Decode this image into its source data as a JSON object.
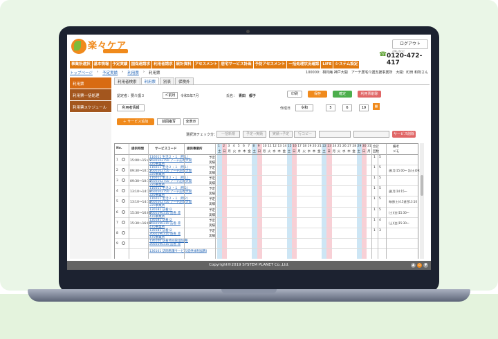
{
  "app": {
    "logo_text": "楽々ケア"
  },
  "header": {
    "logout_label": "ログアウト",
    "tel_label": "お問い合わせ",
    "tel": "0120-472-417"
  },
  "nav": [
    "事業所選択",
    "基本情報",
    "予定実績",
    "国保連請求",
    "利用者請求",
    "統計資料",
    "アセスメント",
    "居宅サービス計画",
    "予防アセスメント",
    "一括処理状況確認",
    "LIFE",
    "システム設定"
  ],
  "breadcrumb": {
    "items": [
      "トップページ",
      "予定実績",
      "利用票",
      "利用票"
    ],
    "office": "100000：相月庵 神戸大開　アーチ居宅介護支援事業所　大開：町田 和則さん"
  },
  "sidebar": [
    "利用票",
    "利用票一括処理",
    "利用票スケジュール"
  ],
  "tabs": [
    "利用者検索",
    "利用票",
    "別表",
    "保険外"
  ],
  "form": {
    "cert_label": "認定者：要介護３",
    "prev_label": "＜前月",
    "month_label": "令和5年7月",
    "name_label": "氏名：",
    "name_value": "青田　都子",
    "print_label": "印刷",
    "save_label": "保存",
    "confirm_label": "確定",
    "release_label": "利用票削除",
    "created_label": "作成日",
    "era": "令和",
    "year": "5",
    "month": "6",
    "day": "19",
    "info_label": "利用者情報",
    "add_service": "＋ サービス追加",
    "copy_prev": "前回複写",
    "display_all": "全表示",
    "bulk_label": "選択済チェック分：",
    "chip_labels": [
      "一括新規",
      "予定→実績",
      "実績→予定",
      "行コピー",
      "",
      ""
    ],
    "delete_service": "サービス削除"
  },
  "grid": {
    "headers": [
      "No.",
      "提供時間",
      "サービスコード",
      "提供事業所"
    ],
    "memo_header": "備考",
    "memo_sub": "メモ",
    "days": [
      "1",
      "2",
      "3",
      "4",
      "5",
      "6",
      "7",
      "8",
      "9",
      "10",
      "11",
      "12",
      "13",
      "14",
      "15",
      "16",
      "17",
      "18",
      "19",
      "20",
      "21",
      "22",
      "23",
      "24",
      "25",
      "26",
      "27",
      "28",
      "29",
      "30",
      "31"
    ],
    "weekdays": [
      "土",
      "日",
      "月",
      "火",
      "水",
      "木",
      "金",
      "土",
      "日",
      "月",
      "火",
      "水",
      "木",
      "金",
      "土",
      "日",
      "月",
      "火",
      "水",
      "木",
      "金",
      "土",
      "日",
      "月",
      "火",
      "水",
      "木",
      "金",
      "土",
      "日",
      "月"
    ],
    "total_label": "合計",
    "count_label": "回数",
    "rows": [
      {
        "no": "1",
        "time": "15:00～15:45",
        "code": "116011 生活２・１（所１）",
        "code2": "2600502750 アーチ訪問大開",
        "office": "220事業所",
        "plan": "予定",
        "actual": "実績",
        "total": "1",
        "count": "5",
        "memo": ""
      },
      {
        "no": "2",
        "time": "09:30～10:15",
        "code": "116011 生活２・１（所１）",
        "code2": "2600502750 アーチ訪問大開",
        "office": "220事業所",
        "plan": "予定",
        "actual": "実績",
        "total": "1",
        "count": "5",
        "memo": "週(月)15:00～ 訪(土)09:30"
      },
      {
        "no": "3",
        "time": "09:30～10:15",
        "code": "116011 生活２・１（所１）",
        "code2": "2600502750 アーチ訪問大開",
        "office": "220事業所",
        "plan": "予定",
        "actual": "実績",
        "total": "1",
        "count": "5",
        "memo": ""
      },
      {
        "no": "4",
        "time": "13:10～14:10",
        "code": "116011 生活２・１（所２）",
        "code2": "2600502750 アーチ訪問大開",
        "office": "220事業所",
        "plan": "予定",
        "actual": "実績",
        "total": "1",
        "count": "5",
        "memo": "週(月)14:15～"
      },
      {
        "no": "5",
        "time": "13:10～14:10",
        "code": "116011 生活２・１（所２）",
        "code2": "2600502750 アーチ訪問大開",
        "office": "220事業所",
        "plan": "予定",
        "actual": "実績",
        "total": "1",
        "count": "5",
        "memo": "毎週(土)4.5週目13:10"
      },
      {
        "no": "6",
        "time": "15:30～16:00",
        "code": "130181 訪看Ⅰ２",
        "code2": "2660590310 訪看 凛",
        "office": "470事業所",
        "plan": "予定",
        "actual": "実績",
        "total": "1",
        "count": "5",
        "memo": "(土)(金)15:30～"
      },
      {
        "no": "7",
        "time": "15:30～16:00",
        "code": "130181 訪看Ⅰ２",
        "code2": "2660590310 訪看 凛",
        "office": "470事業所",
        "plan": "予定",
        "actual": "実績",
        "total": "1",
        "count": "4",
        "memo": "(土)(金)15:30～"
      },
      {
        "no": "8",
        "time": "",
        "code": "130181 訪看Ⅰ２",
        "code2": "2660590310 訪看 凛",
        "office": "470事業所",
        "plan": "予定",
        "actual": "実績",
        "total": "1",
        "count": "3",
        "memo": ""
      },
      {
        "no": "9",
        "time": "",
        "code": "136100 訪看特別管理加算Ⅰ",
        "code2": "2660590310 訪看 凛",
        "office": "",
        "plan": "",
        "actual": "",
        "total": "",
        "count": "",
        "memo": ""
      },
      {
        "no": "",
        "time": "",
        "code": "136101 訪問看護サービス提供体制加算Ⅰ",
        "code2": "",
        "office": "",
        "plan": "",
        "actual": "",
        "total": "",
        "count": "",
        "memo": ""
      }
    ]
  },
  "footer": {
    "copyright": "Copyright©2019 SYSTEM PLANET Co.,Ltd."
  },
  "colors": {
    "accent": "#e07a10",
    "brown": "#a3561e",
    "sat_col": "#cde6f5",
    "sun_col": "#f8d0d6",
    "save_btn": "#f08a1c",
    "confirm_btn": "#4cae4c",
    "delete_btn": "#e06666"
  }
}
